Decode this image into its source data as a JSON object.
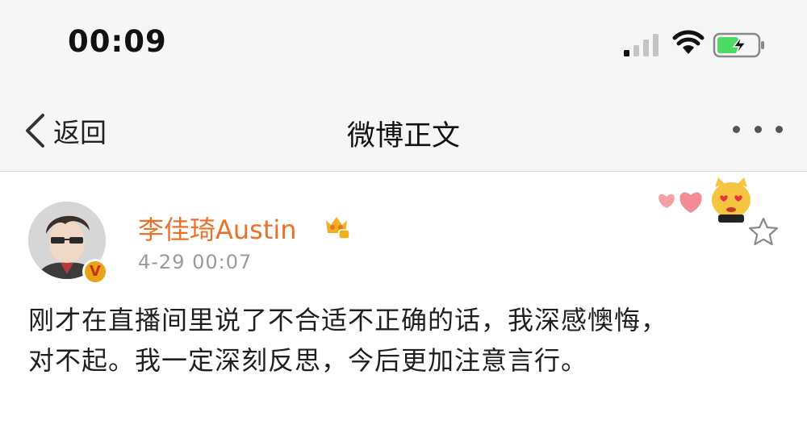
{
  "status_bar": {
    "time": "00:09",
    "signal_icon": "cellular-signal-icon",
    "wifi_icon": "wifi-icon",
    "battery_icon": "battery-charging-icon",
    "battery_color": "#4cd964"
  },
  "nav": {
    "back_label": "返回",
    "title": "微博正文",
    "more_icon": "more-dots-icon"
  },
  "post": {
    "username": "李佳琦Austin",
    "username_color": "#e8722b",
    "timestamp": "4-29 00:07",
    "verified_badge": "V",
    "text_lines": [
      "刚才在直播间里说了不合适不正确的话，我深感懊悔，",
      "对不起。我一定深刻反思，今后更加注意言行。"
    ]
  },
  "icons": {
    "favorite": "star-outline-icon",
    "vip": "crown-vip-icon",
    "decoration": "hearts-cat-decoration"
  }
}
